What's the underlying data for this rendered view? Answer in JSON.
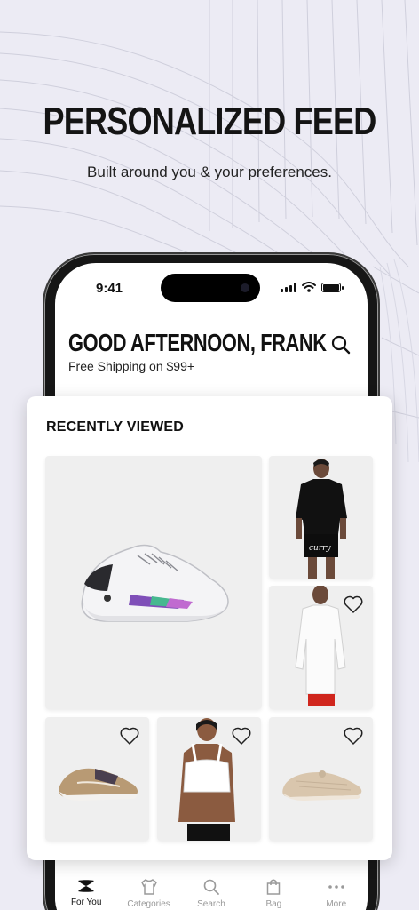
{
  "promo": {
    "headline": "PERSONALIZED FEED",
    "subhead": "Built around you & your preferences."
  },
  "status_bar": {
    "time": "9:41"
  },
  "header": {
    "greeting": "GOOD AFTERNOON, FRANK",
    "shipping": "Free Shipping on $99+",
    "search_icon": "search-icon"
  },
  "recently_viewed": {
    "title": "RECENTLY VIEWED",
    "items": [
      {
        "name": "white basketball shoe",
        "favorite": false
      },
      {
        "name": "black graphic t-shirt",
        "favorite": false
      },
      {
        "name": "white long sleeve shirt",
        "favorite": false
      },
      {
        "name": "tan running shoe",
        "favorite": false
      },
      {
        "name": "white sports bra",
        "favorite": false
      },
      {
        "name": "beige slip-on shoe",
        "favorite": false
      }
    ]
  },
  "tabbar": {
    "items": [
      {
        "label": "For You",
        "icon": "ua-logo-icon",
        "active": true
      },
      {
        "label": "Categories",
        "icon": "shirt-icon",
        "active": false
      },
      {
        "label": "Search",
        "icon": "search-icon",
        "active": false
      },
      {
        "label": "Bag",
        "icon": "bag-icon",
        "active": false
      },
      {
        "label": "More",
        "icon": "more-dots-icon",
        "active": false
      }
    ]
  },
  "colors": {
    "background": "#ecebf4",
    "tile": "#efefef",
    "text": "#111111",
    "inactive_tab": "#9a9a9a"
  }
}
